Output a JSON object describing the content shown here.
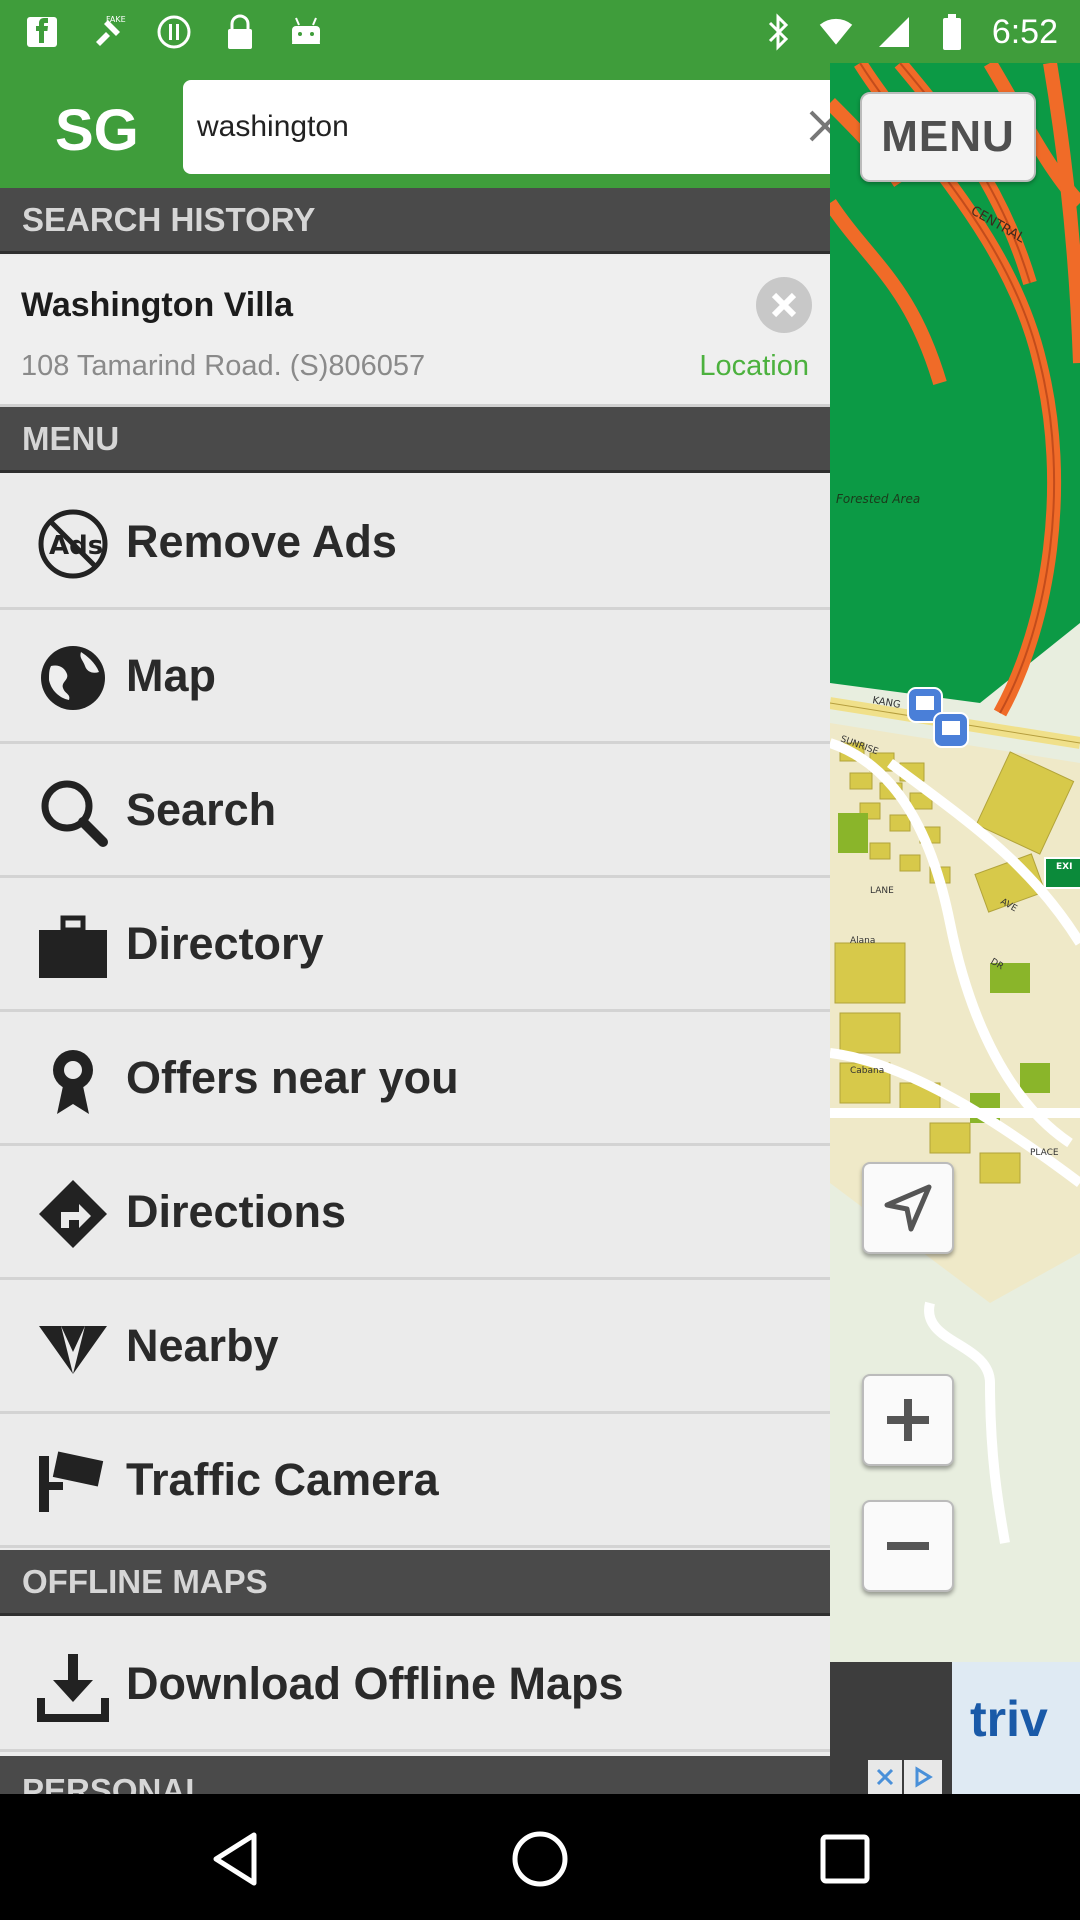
{
  "status_bar": {
    "time": "6:52",
    "left_icons": [
      "notification-f-icon",
      "fake-gps-icon",
      "info-circle-icon",
      "lock-icon",
      "android-icon"
    ],
    "right_icons": [
      "bluetooth-icon",
      "wifi-icon",
      "signal-icon",
      "battery-icon"
    ]
  },
  "header": {
    "logo": "SG",
    "search_value": "washington",
    "search_placeholder": "",
    "menu_button": "MENU"
  },
  "search_history": {
    "title": "SEARCH HISTORY",
    "items": [
      {
        "name": "Washington Villa",
        "address": "108 Tamarind Road. (S)806057",
        "action": "Location"
      }
    ]
  },
  "menu": {
    "title": "MENU",
    "items": [
      {
        "label": "Remove Ads",
        "icon": "no-ads-icon"
      },
      {
        "label": "Map",
        "icon": "globe-icon"
      },
      {
        "label": "Search",
        "icon": "search-icon"
      },
      {
        "label": "Directory",
        "icon": "briefcase-icon"
      },
      {
        "label": "Offers near you",
        "icon": "award-ribbon-icon"
      },
      {
        "label": "Directions",
        "icon": "directions-icon"
      },
      {
        "label": "Nearby",
        "icon": "nearby-icon"
      },
      {
        "label": "Traffic Camera",
        "icon": "camera-icon"
      }
    ]
  },
  "offline_maps": {
    "title": "OFFLINE MAPS",
    "items": [
      {
        "label": "Download Offline Maps",
        "icon": "download-icon"
      }
    ]
  },
  "personal": {
    "title": "PERSONAL"
  },
  "map": {
    "labels": {
      "central": "CENTRAL",
      "forested": "Forested Area",
      "kang": "KANG",
      "sunrise": "SUNRISE",
      "lane": "LANE",
      "ave": "AVE",
      "dr": "DR",
      "place": "PLACE",
      "alana": "Alana",
      "cabana": "Cabana",
      "exit": "EXI"
    },
    "controls": [
      "navigate-icon",
      "zoom-in-icon",
      "zoom-out-icon"
    ]
  },
  "ad": {
    "text": "triv"
  },
  "colors": {
    "brand_green": "#3f9d3b",
    "section_dark": "#4a4a4a",
    "map_park": "#0c9a45",
    "road_orange": "#f06b28",
    "location_green": "#4cb13e"
  }
}
